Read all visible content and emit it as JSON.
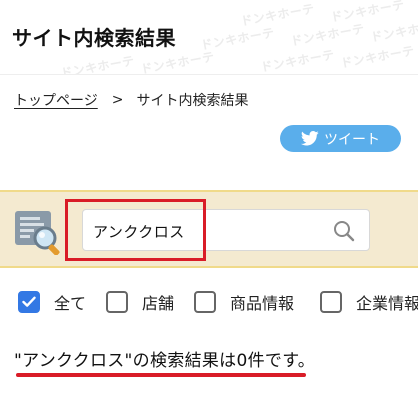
{
  "header": {
    "title": "サイト内検索結果",
    "watermark": "ドンキホーテ"
  },
  "breadcrumb": {
    "home": "トップページ",
    "separator": ">",
    "current": "サイト内検索結果"
  },
  "share": {
    "tweet_label": "ツイート"
  },
  "search": {
    "value": "アンククロス"
  },
  "filters": [
    {
      "label": "全て",
      "checked": true
    },
    {
      "label": "店舗",
      "checked": false
    },
    {
      "label": "商品情報",
      "checked": false
    },
    {
      "label": "企業情報",
      "checked": false
    }
  ],
  "result": {
    "text": "\"アンククロス\"の検索結果は0件です。"
  },
  "colors": {
    "tweet": "#5aaeeb",
    "highlight": "#d91c27",
    "checkbox_on": "#3378e4",
    "search_band": "#f4ead0"
  }
}
